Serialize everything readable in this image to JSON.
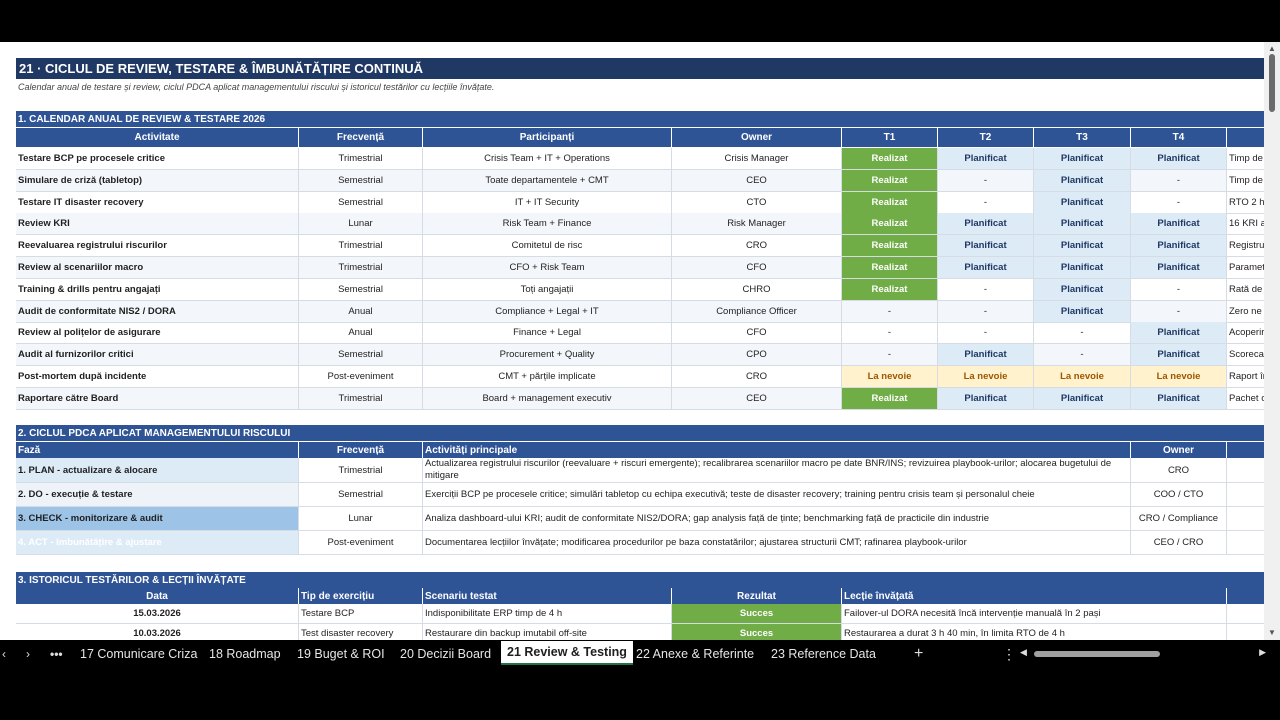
{
  "title": "21 · CICLUL DE REVIEW, TESTARE & ÎMBUNĂTĂȚIRE CONTINUĂ",
  "subtitle": "Calendar anual de testare și review, ciclul PDCA aplicat managementului riscului și istoricul testărilor cu lecțiile învățate.",
  "colors": {
    "header": "#2f5496",
    "banner": "#1f3864",
    "success": "#70ad47",
    "planned": "#ddebf7",
    "need": "#fff2cc"
  },
  "section1": {
    "title": "1. CALENDAR ANUAL DE REVIEW & TESTARE 2026",
    "headers": [
      "Activitate",
      "Frecvență",
      "Participanți",
      "Owner",
      "T1",
      "T2",
      "T3",
      "T4",
      ""
    ],
    "rows": [
      [
        "Testare BCP pe procesele critice",
        "Trimestrial",
        "Crisis Team + IT + Operations",
        "Crisis Manager",
        "Realizat",
        "Planificat",
        "Planificat",
        "Planificat",
        "Timp de"
      ],
      [
        "Simulare de criză (tabletop)",
        "Semestrial",
        "Toate departamentele + CMT",
        "CEO",
        "Realizat",
        "-",
        "Planificat",
        "-",
        "Timp de"
      ],
      [
        "Testare IT disaster recovery",
        "Semestrial",
        "IT + IT Security",
        "CTO",
        "Realizat",
        "-",
        "Planificat",
        "-",
        "RTO 2 h"
      ],
      [
        "Review KRI",
        "Lunar",
        "Risk Team + Finance",
        "Risk Manager",
        "Realizat",
        "Planificat",
        "Planificat",
        "Planificat",
        "16 KRI a"
      ],
      [
        "Reevaluarea registrului riscurilor",
        "Trimestrial",
        "Comitetul de risc",
        "CRO",
        "Realizat",
        "Planificat",
        "Planificat",
        "Planificat",
        "Registru"
      ],
      [
        "Review al scenariilor macro",
        "Trimestrial",
        "CFO + Risk Team",
        "CFO",
        "Realizat",
        "Planificat",
        "Planificat",
        "Planificat",
        "Paramet"
      ],
      [
        "Training & drills pentru angajați",
        "Semestrial",
        "Toți angajații",
        "CHRO",
        "Realizat",
        "-",
        "Planificat",
        "-",
        "Rată de"
      ],
      [
        "Audit de conformitate NIS2 / DORA",
        "Anual",
        "Compliance + Legal + IT",
        "Compliance Officer",
        "-",
        "-",
        "Planificat",
        "-",
        "Zero ne"
      ],
      [
        "Review al polițelor de asigurare",
        "Anual",
        "Finance + Legal",
        "CFO",
        "-",
        "-",
        "-",
        "Planificat",
        "Acoperir"
      ],
      [
        "Audit al furnizorilor critici",
        "Semestrial",
        "Procurement + Quality",
        "CPO",
        "-",
        "Planificat",
        "-",
        "Planificat",
        "Scoreca"
      ],
      [
        "Post-mortem după incidente",
        "Post-eveniment",
        "CMT + părțile implicate",
        "CRO",
        "La nevoie",
        "La nevoie",
        "La nevoie",
        "La nevoie",
        "Raport în"
      ],
      [
        "Raportare către Board",
        "Trimestrial",
        "Board + management executiv",
        "CEO",
        "Realizat",
        "Planificat",
        "Planificat",
        "Planificat",
        "Pachet c"
      ]
    ]
  },
  "section2": {
    "title": "2. CICLUL PDCA APLICAT MANAGEMENTULUI RISCULUI",
    "headers": [
      "Fază",
      "Frecvență",
      "Activități principale",
      "Owner",
      ""
    ],
    "rows": [
      [
        "1. PLAN - actualizare & alocare",
        "Trimestrial",
        "Actualizarea registrului riscurilor (reevaluare + riscuri emergente); recalibrarea scenariilor macro pe date BNR/INS; revizuirea playbook-urilor; alocarea bugetului de mitigare",
        "CRO"
      ],
      [
        "2. DO - execuție & testare",
        "Semestrial",
        "Exerciții BCP pe procesele critice; simulări tabletop cu echipa executivă; teste de disaster recovery; training pentru crisis team și personalul cheie",
        "COO / CTO"
      ],
      [
        "3. CHECK - monitorizare & audit",
        "Lunar",
        "Analiza dashboard-ului KRI; audit de conformitate NIS2/DORA; gap analysis față de ținte; benchmarking față de practicile din industrie",
        "CRO / Compliance"
      ],
      [
        "4. ACT - îmbunătățire & ajustare",
        "Post-eveniment",
        "Documentarea lecțiilor învățate; modificarea procedurilor pe baza constatărilor; ajustarea structurii CMT; rafinarea playbook-urilor",
        "CEO / CRO"
      ]
    ]
  },
  "section3": {
    "title": "3. ISTORICUL TESTĂRILOR & LECȚII ÎNVĂȚATE",
    "headers": [
      "Data",
      "Tip de exercițiu",
      "Scenariu testat",
      "Rezultat",
      "Lecție învățată",
      ""
    ],
    "rows": [
      [
        "15.03.2026",
        "Testare BCP",
        "Indisponibilitate ERP timp de 4 h",
        "Succes",
        "Failover-ul DORA necesită încă intervenție manuală în 2 pași"
      ],
      [
        "10.03.2026",
        "Test disaster recovery",
        "Restaurare din backup imutabil off-site",
        "Succes",
        "Restaurarea a durat 3 h 40 min, în limita RTO de 4 h"
      ]
    ]
  },
  "tabs": {
    "items": [
      "17 Comunicare Criza",
      "18 Roadmap",
      "19 Buget & ROI",
      "20 Decizii Board",
      "21 Review & Testing",
      "22 Anexe & Referinte",
      "23 Reference Data"
    ],
    "active": "21 Review & Testing"
  }
}
